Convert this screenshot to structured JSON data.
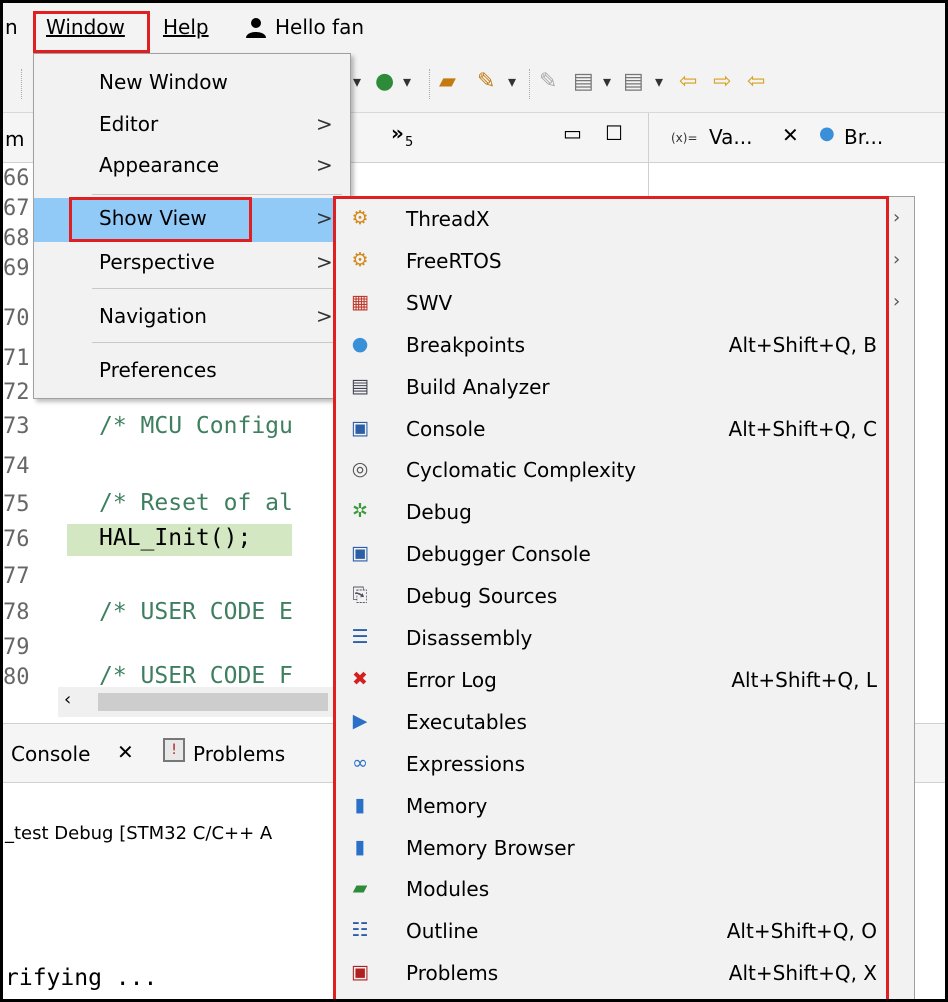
{
  "menubar": {
    "partial_left": "n",
    "window": "Window",
    "help": "Help",
    "user": "Hello fan"
  },
  "editor": {
    "tab_partial": "m",
    "overflow_count": "»",
    "overflow_num": "5",
    "lines": [
      {
        "n": "66",
        "code": ""
      },
      {
        "n": "67",
        "code": ""
      },
      {
        "n": "68",
        "code": ""
      },
      {
        "n": "69",
        "code": ""
      },
      {
        "n": "70",
        "code": ""
      },
      {
        "n": "71",
        "code": ""
      },
      {
        "n": "72",
        "code": ""
      },
      {
        "n": "73",
        "code": "/* MCU Configu"
      },
      {
        "n": "74",
        "code": ""
      },
      {
        "n": "75",
        "code": "/* Reset of al"
      },
      {
        "n": "76",
        "code": "HAL_Init();"
      },
      {
        "n": "77",
        "code": ""
      },
      {
        "n": "78",
        "code": "/* USER CODE E"
      },
      {
        "n": "79",
        "code": ""
      },
      {
        "n": "80",
        "code": "/* USER CODE F"
      }
    ]
  },
  "right_panel": {
    "tab_variables": "Va...",
    "tab_breakpoints": "Br...",
    "var_prefix": "(x)="
  },
  "console": {
    "tab_console": "Console",
    "tab_problems": "Problems",
    "launch_text": "_test Debug [STM32 C/C++ A",
    "status_text": "rifying ..."
  },
  "window_menu": {
    "items": [
      {
        "label": "New Window",
        "arrow": ""
      },
      {
        "label": "Editor",
        "arrow": ">"
      },
      {
        "label": "Appearance",
        "arrow": ">"
      },
      {
        "label": "Show View",
        "arrow": ">"
      },
      {
        "label": "Perspective",
        "arrow": ">"
      },
      {
        "label": "Navigation",
        "arrow": ">"
      },
      {
        "label": "Preferences",
        "arrow": ""
      }
    ]
  },
  "show_view_menu": {
    "items": [
      {
        "label": "ThreadX",
        "shortcut": "",
        "icon": "threads-icon",
        "glyph": "⚙",
        "color": "#d28a1e",
        "submenu": true
      },
      {
        "label": "FreeRTOS",
        "shortcut": "",
        "icon": "threads-icon",
        "glyph": "⚙",
        "color": "#d28a1e",
        "submenu": true
      },
      {
        "label": "SWV",
        "shortcut": "",
        "icon": "table-icon",
        "glyph": "▦",
        "color": "#c0392b",
        "submenu": true
      },
      {
        "label": "Breakpoints",
        "shortcut": "Alt+Shift+Q, B",
        "icon": "breakpoints-icon",
        "glyph": "●",
        "color": "#3a8fd9",
        "submenu": false
      },
      {
        "label": "Build Analyzer",
        "shortcut": "",
        "icon": "binary-file-icon",
        "glyph": "▤",
        "color": "#445",
        "submenu": false
      },
      {
        "label": "Console",
        "shortcut": "Alt+Shift+Q, C",
        "icon": "console-icon",
        "glyph": "▣",
        "color": "#2a5fa8",
        "submenu": false
      },
      {
        "label": "Cyclomatic Complexity",
        "shortcut": "",
        "icon": "complexity-icon",
        "glyph": "◎",
        "color": "#555",
        "submenu": false
      },
      {
        "label": "Debug",
        "shortcut": "",
        "icon": "bug-icon",
        "glyph": "✲",
        "color": "#3a9a3a",
        "submenu": false
      },
      {
        "label": "Debugger Console",
        "shortcut": "",
        "icon": "debugger-console-icon",
        "glyph": "▣",
        "color": "#2a5fa8",
        "submenu": false
      },
      {
        "label": "Debug Sources",
        "shortcut": "",
        "icon": "debug-sources-icon",
        "glyph": "⎘",
        "color": "#556",
        "submenu": false
      },
      {
        "label": "Disassembly",
        "shortcut": "",
        "icon": "disassembly-icon",
        "glyph": "☰",
        "color": "#2a5fa8",
        "submenu": false
      },
      {
        "label": "Error Log",
        "shortcut": "Alt+Shift+Q, L",
        "icon": "error-log-icon",
        "glyph": "✖",
        "color": "#d32020",
        "submenu": false
      },
      {
        "label": "Executables",
        "shortcut": "",
        "icon": "executables-icon",
        "glyph": "▶",
        "color": "#2a6fc8",
        "submenu": false
      },
      {
        "label": "Expressions",
        "shortcut": "",
        "icon": "expressions-icon",
        "glyph": "∞",
        "color": "#2a6fc8",
        "submenu": false
      },
      {
        "label": "Memory",
        "shortcut": "",
        "icon": "memory-icon",
        "glyph": "▮",
        "color": "#2a6fc8",
        "submenu": false
      },
      {
        "label": "Memory Browser",
        "shortcut": "",
        "icon": "memory-icon",
        "glyph": "▮",
        "color": "#2a6fc8",
        "submenu": false
      },
      {
        "label": "Modules",
        "shortcut": "",
        "icon": "modules-icon",
        "glyph": "▰",
        "color": "#2e8b3a",
        "submenu": false
      },
      {
        "label": "Outline",
        "shortcut": "Alt+Shift+Q, O",
        "icon": "outline-icon",
        "glyph": "☷",
        "color": "#2a5fa8",
        "submenu": false
      },
      {
        "label": "Problems",
        "shortcut": "Alt+Shift+Q, X",
        "icon": "problems-icon",
        "glyph": "▣",
        "color": "#b02020",
        "submenu": false
      }
    ]
  },
  "colors": {
    "highlight_box": "#e02020",
    "menu_selected": "#91c9f7",
    "code_comment": "#3f7f5f",
    "current_line": "#d3e7c2"
  }
}
